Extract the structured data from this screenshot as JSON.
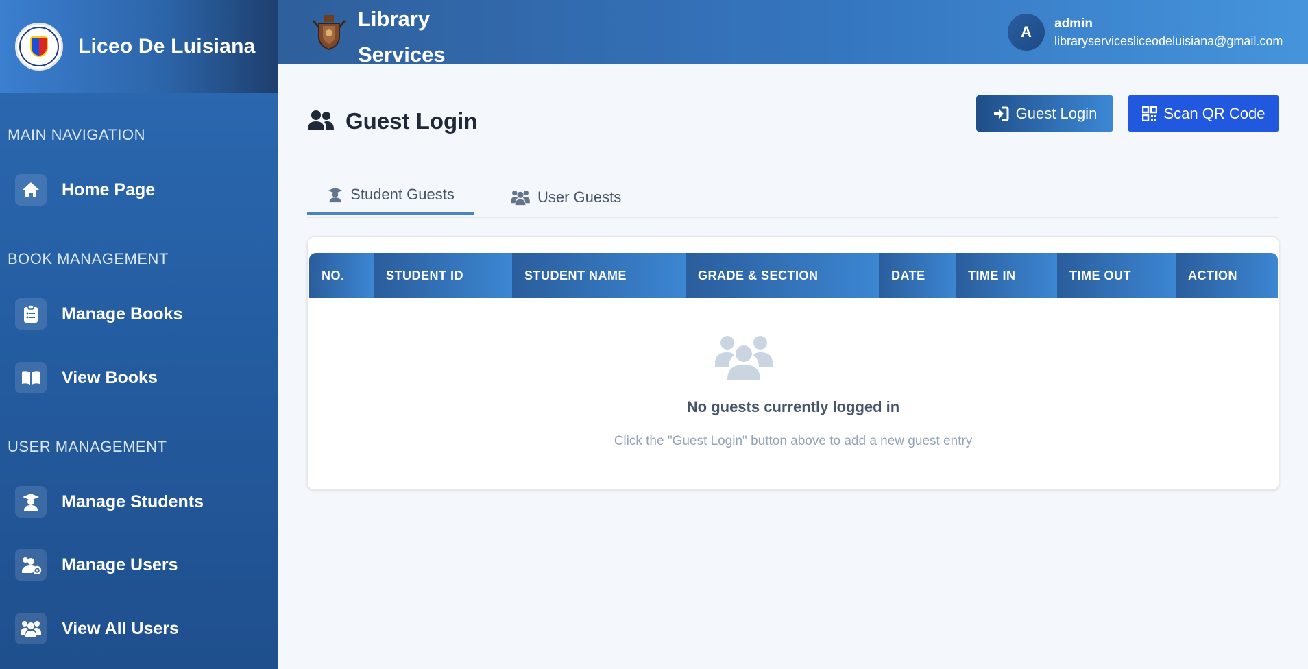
{
  "sidebar": {
    "brand": "Liceo De Luisiana",
    "sections": [
      {
        "title": "MAIN NAVIGATION",
        "items": [
          {
            "label": "Home Page",
            "icon": "home-icon"
          }
        ]
      },
      {
        "title": "BOOK MANAGEMENT",
        "items": [
          {
            "label": "Manage Books",
            "icon": "clipboard-list-icon"
          },
          {
            "label": "View Books",
            "icon": "book-open-icon"
          }
        ]
      },
      {
        "title": "USER MANAGEMENT",
        "items": [
          {
            "label": "Manage Students",
            "icon": "graduate-icon"
          },
          {
            "label": "Manage Users",
            "icon": "users-gear-icon"
          },
          {
            "label": "View All Users",
            "icon": "users-icon"
          }
        ]
      }
    ]
  },
  "topbar": {
    "title_line1": "Library",
    "title_line2": "Services",
    "user": {
      "initial": "A",
      "name": "admin",
      "email": "libraryservicesliceodeluisiana@gmail.com"
    }
  },
  "main": {
    "page_title": "Guest Login",
    "buttons": {
      "guest_login": "Guest Login",
      "scan_qr": "Scan QR Code"
    },
    "tabs": [
      {
        "label": "Student Guests",
        "active": true
      },
      {
        "label": "User Guests",
        "active": false
      }
    ],
    "table": {
      "columns": [
        "NO.",
        "STUDENT ID",
        "STUDENT NAME",
        "GRADE & SECTION",
        "DATE",
        "TIME IN",
        "TIME OUT",
        "ACTION"
      ],
      "rows": []
    },
    "empty_state": {
      "title": "No guests currently logged in",
      "subtitle": "Click the \"Guest Login\" button above to add a new guest entry"
    }
  },
  "colors": {
    "accent": "#2158e0",
    "sidebar": "#255ea3",
    "header_gradient_end": "#4594dc"
  }
}
